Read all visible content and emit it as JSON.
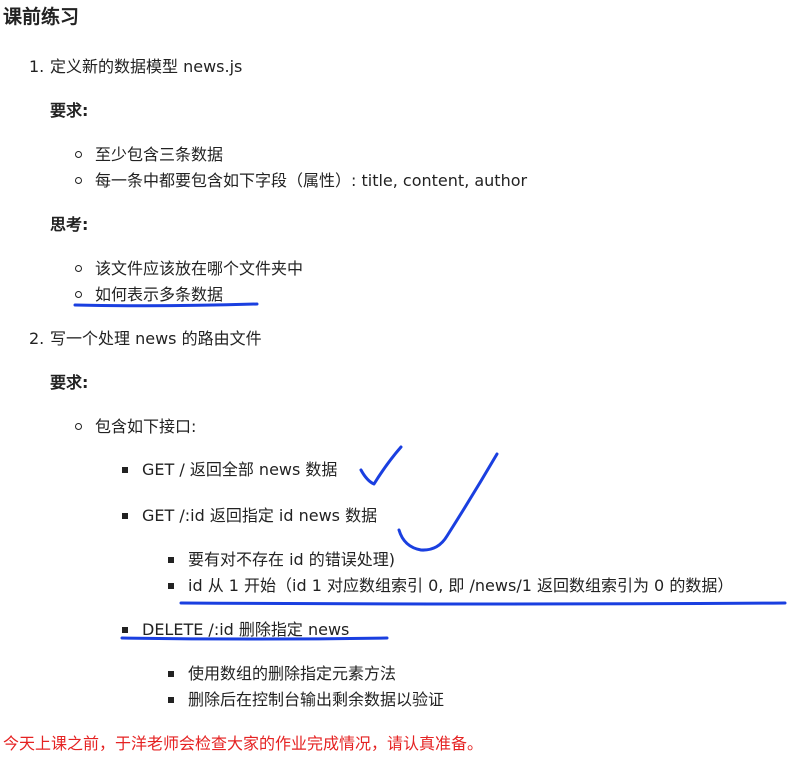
{
  "title": "课前练习",
  "task1": {
    "number": "1.",
    "heading": "定义新的数据模型 news.js",
    "requirements_label": "要求:",
    "requirements": [
      "至少包含三条数据",
      "每一条中都要包含如下字段（属性）: title, content, author"
    ],
    "thinking_label": "思考:",
    "thinking": [
      "该文件应该放在哪个文件夹中",
      "如何表示多条数据"
    ]
  },
  "task2": {
    "number": "2.",
    "heading": "写一个处理 news 的路由文件",
    "requirements_label": "要求:",
    "interface_item": "包含如下接口:",
    "endpoints": [
      {
        "label": "GET / 返回全部 news 数据"
      },
      {
        "label": "GET /:id 返回指定 id news 数据",
        "notes": [
          "要有对不存在 id 的错误处理)",
          "id 从 1 开始（id 1 对应数组索引 0, 即 /news/1 返回数组索引为 0 的数据）"
        ]
      },
      {
        "label": "DELETE /:id 删除指定 news",
        "notes": [
          "使用数组的删除指定元素方法",
          "删除后在控制台输出剩余数据以验证"
        ]
      }
    ]
  },
  "footer_notice": "今天上课之前，于洋老师会检查大家的作业完成情况，请认真准备。",
  "colors": {
    "text": "#222222",
    "notice": "#e52222",
    "annotation": "#1a3fe0"
  }
}
